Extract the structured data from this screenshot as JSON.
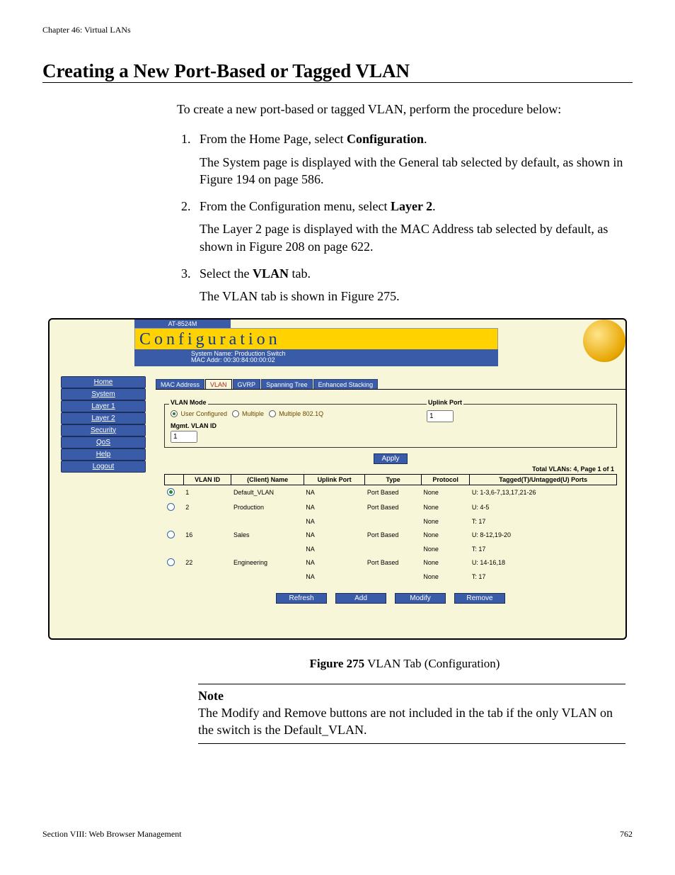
{
  "chapter": "Chapter 46: Virtual LANs",
  "title": "Creating a New Port-Based or Tagged VLAN",
  "intro": "To create a new port-based or tagged VLAN, perform the procedure below:",
  "steps": {
    "s1_pre": "From the Home Page, select ",
    "s1_bold": "Configuration",
    "s1_post": ".",
    "s1_body": "The System page is displayed with the General tab selected by default, as shown in Figure 194 on page 586.",
    "s2_pre": "From the Configuration menu, select ",
    "s2_bold": "Layer 2",
    "s2_post": ".",
    "s2_body": "The Layer 2 page is displayed with the MAC Address tab selected by default, as shown in Figure 208 on page 622.",
    "s3_pre": "Select the ",
    "s3_bold": "VLAN",
    "s3_post": " tab.",
    "s3_body": "The VLAN tab is shown in Figure 275."
  },
  "screenshot": {
    "model": "AT-8524M",
    "banner": "Configuration",
    "system_name_label": "System Name: ",
    "system_name": "Production Switch",
    "mac_label": "MAC Addr: ",
    "mac_addr": "00:30:84:00:00:02",
    "sidebar": [
      "Home",
      "System",
      "Layer 1",
      "Layer 2",
      "Security",
      "QoS",
      "Help",
      "Logout"
    ],
    "tabs": [
      "MAC Address",
      "VLAN",
      "GVRP",
      "Spanning Tree",
      "Enhanced Stacking"
    ],
    "active_tab": "VLAN",
    "vlan_mode_legend": "VLAN Mode",
    "uplink_legend": "Uplink Port",
    "vlan_modes": [
      "User Configured",
      "Multiple",
      "Multiple 802.1Q"
    ],
    "uplink_value": "1",
    "mgmt_label": "Mgmt. VLAN ID",
    "mgmt_value": "1",
    "apply_btn": "Apply",
    "total_vlans": "Total VLANs: 4, Page 1 of 1",
    "columns": [
      "",
      "VLAN ID",
      "(Client) Name",
      "Uplink Port",
      "Type",
      "Protocol",
      "Tagged(T)/Untagged(U) Ports"
    ],
    "rows": [
      {
        "sel": true,
        "id": "1",
        "name": "Default_VLAN",
        "uplink": "NA",
        "type": "Port Based",
        "proto": "None",
        "ports": "U: 1-3,6-7,13,17,21-26"
      },
      {
        "sel": false,
        "id": "2",
        "name": "Production",
        "uplink": "NA",
        "type": "Port Based",
        "proto": "None",
        "ports": "U: 4-5"
      },
      {
        "sel": null,
        "id": "",
        "name": "",
        "uplink": "NA",
        "type": "",
        "proto": "None",
        "ports": "T: 17"
      },
      {
        "sel": false,
        "id": "16",
        "name": "Sales",
        "uplink": "NA",
        "type": "Port Based",
        "proto": "None",
        "ports": "U: 8-12,19-20"
      },
      {
        "sel": null,
        "id": "",
        "name": "",
        "uplink": "NA",
        "type": "",
        "proto": "None",
        "ports": "T: 17"
      },
      {
        "sel": false,
        "id": "22",
        "name": "Engineering",
        "uplink": "NA",
        "type": "Port Based",
        "proto": "None",
        "ports": "U: 14-16,18"
      },
      {
        "sel": null,
        "id": "",
        "name": "",
        "uplink": "NA",
        "type": "",
        "proto": "None",
        "ports": "T: 17"
      }
    ],
    "buttons": [
      "Refresh",
      "Add",
      "Modify",
      "Remove"
    ]
  },
  "figure": {
    "label": "Figure 275",
    "caption": "  VLAN Tab (Configuration)"
  },
  "note": {
    "label": "Note",
    "text": "The Modify and Remove buttons are not included in the tab if the only VLAN on the switch is the Default_VLAN."
  },
  "footer": {
    "section": "Section VIII: Web Browser Management",
    "page": "762"
  }
}
